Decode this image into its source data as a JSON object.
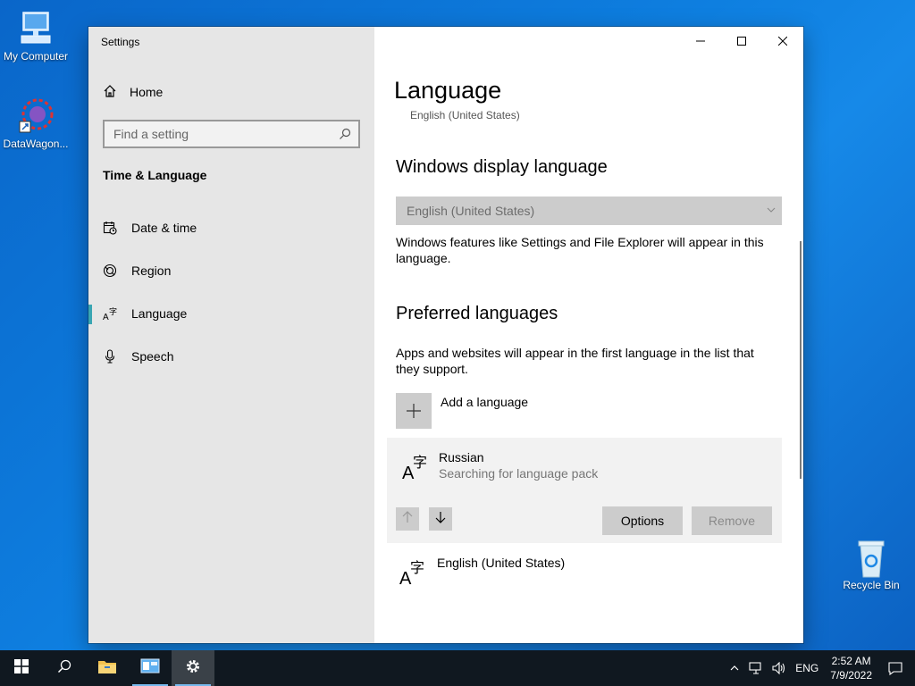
{
  "desktop": {
    "icons": [
      {
        "label": "My Computer"
      },
      {
        "label": "DataWagon..."
      },
      {
        "label": "Recycle Bin"
      }
    ]
  },
  "window": {
    "title": "Settings",
    "controls": {
      "minimize": "minimize",
      "maximize": "maximize",
      "close": "close"
    }
  },
  "sidebar": {
    "home": "Home",
    "search_placeholder": "Find a setting",
    "section": "Time & Language",
    "items": [
      {
        "label": "Date & time",
        "icon": "calendar-clock-icon"
      },
      {
        "label": "Region",
        "icon": "globe-icon"
      },
      {
        "label": "Language",
        "icon": "language-icon",
        "active": true
      },
      {
        "label": "Speech",
        "icon": "microphone-icon"
      }
    ],
    "accent": "#3aa6b3"
  },
  "main": {
    "title": "Language",
    "subtitle": "English (United States)",
    "display_language": {
      "heading": "Windows display language",
      "selected": "English (United States)",
      "description": "Windows features like Settings and File Explorer will appear in this language."
    },
    "preferred": {
      "heading": "Preferred languages",
      "description": "Apps and websites will appear in the first language in the list that they support.",
      "add_label": "Add a language",
      "languages": [
        {
          "name": "Russian",
          "status": "Searching for language pack"
        },
        {
          "name": "English (United States)",
          "status": ""
        }
      ],
      "options_label": "Options",
      "remove_label": "Remove"
    }
  },
  "taskbar": {
    "language": "ENG",
    "time": "2:52 AM",
    "date": "7/9/2022"
  }
}
